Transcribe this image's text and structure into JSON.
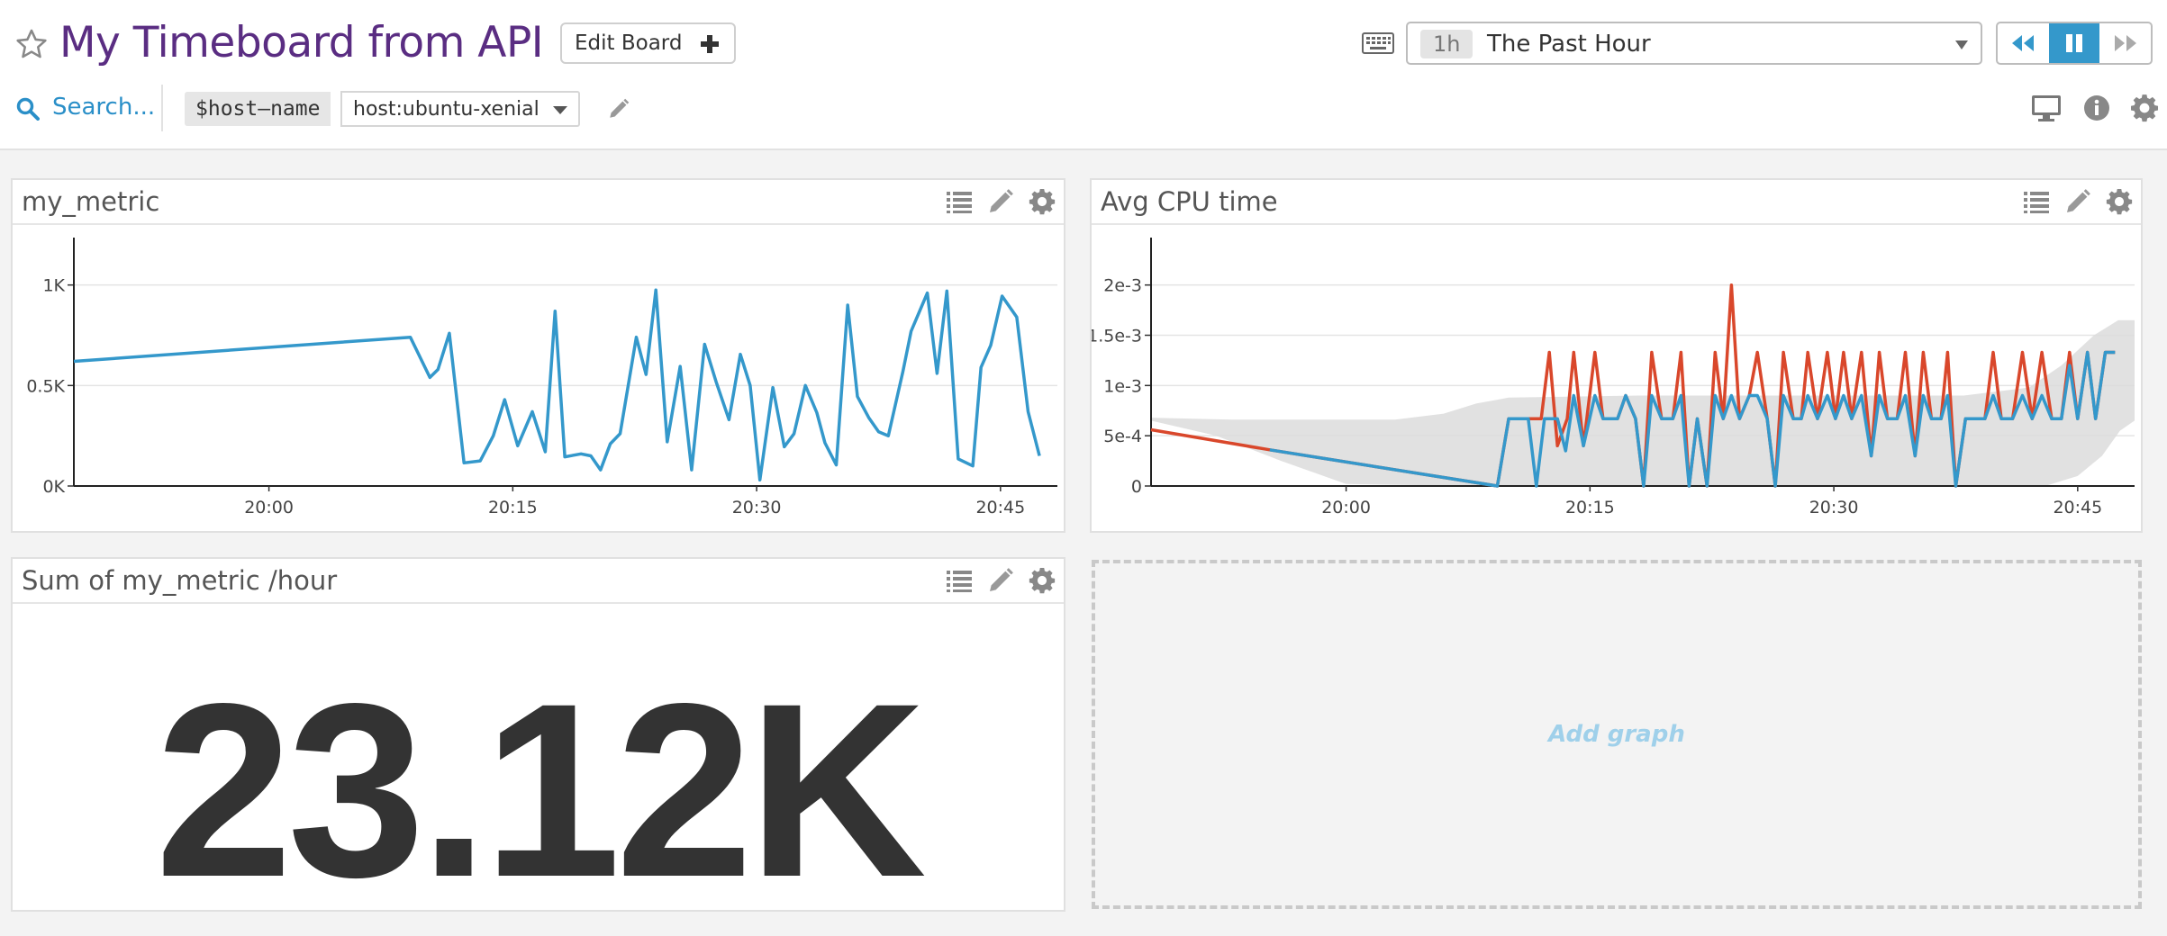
{
  "header": {
    "title": "My Timeboard from API",
    "edit_board_label": "Edit Board",
    "timeframe": {
      "abbr": "1h",
      "label": "The Past Hour"
    },
    "search_label": "Search...",
    "template_variable": {
      "name": "$host–name",
      "value": "host:ubuntu-xenial"
    }
  },
  "colors": {
    "accent": "#3498cb",
    "title": "#5a2d82",
    "series_red": "#d9472b",
    "band": "#dcdcdc"
  },
  "widgets": {
    "my_metric": {
      "title": "my_metric"
    },
    "avg_cpu": {
      "title": "Avg CPU time"
    },
    "sum_metric": {
      "title": "Sum of my_metric /hour",
      "value": "23.12K"
    },
    "add_graph": {
      "label": "Add graph"
    }
  },
  "chart_data": [
    {
      "type": "line",
      "id": "my_metric",
      "title": "my_metric",
      "x_ticks": [
        "20:00",
        "20:15",
        "20:30",
        "20:45"
      ],
      "x_tick_minutes": [
        12,
        27,
        42,
        57
      ],
      "xlim_minutes": [
        0,
        60.5
      ],
      "y_ticks": [
        "0K",
        "0.5K",
        "1K"
      ],
      "y_tick_values": [
        0,
        500,
        1000
      ],
      "ylim": [
        0,
        1200
      ],
      "series": [
        {
          "color": "#3498cb",
          "points": [
            [
              0,
              620
            ],
            [
              20.7,
              740
            ],
            [
              21.9,
              540
            ],
            [
              22.4,
              580
            ],
            [
              23.1,
              760
            ],
            [
              24,
              115
            ],
            [
              25,
              125
            ],
            [
              25.8,
              250
            ],
            [
              26.5,
              430
            ],
            [
              27.3,
              200
            ],
            [
              28.2,
              370
            ],
            [
              29,
              170
            ],
            [
              29.6,
              870
            ],
            [
              30.2,
              145
            ],
            [
              31.2,
              160
            ],
            [
              31.8,
              150
            ],
            [
              32.4,
              80
            ],
            [
              33,
              210
            ],
            [
              33.6,
              260
            ],
            [
              34.6,
              740
            ],
            [
              35.2,
              555
            ],
            [
              35.8,
              975
            ],
            [
              36.5,
              220
            ],
            [
              37.3,
              595
            ],
            [
              38,
              80
            ],
            [
              38.8,
              705
            ],
            [
              39.5,
              520
            ],
            [
              40.3,
              330
            ],
            [
              41,
              655
            ],
            [
              41.6,
              500
            ],
            [
              42.2,
              30
            ],
            [
              43,
              490
            ],
            [
              43.7,
              195
            ],
            [
              44.3,
              260
            ],
            [
              45,
              500
            ],
            [
              45.7,
              365
            ],
            [
              46.2,
              215
            ],
            [
              46.9,
              105
            ],
            [
              47.6,
              900
            ],
            [
              48.2,
              445
            ],
            [
              48.9,
              340
            ],
            [
              49.5,
              270
            ],
            [
              50.1,
              250
            ],
            [
              51,
              570
            ],
            [
              51.5,
              770
            ],
            [
              52.5,
              960
            ],
            [
              53.1,
              560
            ],
            [
              53.7,
              970
            ],
            [
              54.4,
              135
            ],
            [
              55.3,
              100
            ],
            [
              55.8,
              590
            ],
            [
              56.4,
              700
            ],
            [
              57.1,
              945
            ],
            [
              58,
              840
            ],
            [
              58.7,
              370
            ],
            [
              59.4,
              150
            ]
          ]
        }
      ]
    },
    {
      "type": "line",
      "id": "avg_cpu",
      "title": "Avg CPU time",
      "x_ticks": [
        "20:00",
        "20:15",
        "20:30",
        "20:45"
      ],
      "x_tick_minutes": [
        12,
        27,
        42,
        57
      ],
      "xlim_minutes": [
        0,
        60.5
      ],
      "y_ticks": [
        "0",
        "5e-4",
        "1e-3",
        "1.5e-3",
        "2e-3"
      ],
      "y_tick_values": [
        0,
        0.0005,
        0.001,
        0.0015,
        0.002
      ],
      "ylim": [
        0,
        0.0024
      ],
      "band": {
        "upper": [
          [
            0,
            0.00068
          ],
          [
            5,
            0.00066
          ],
          [
            10,
            0.00066
          ],
          [
            15,
            0.00066
          ],
          [
            18,
            0.00072
          ],
          [
            20,
            0.00082
          ],
          [
            22,
            0.00088
          ],
          [
            30,
            0.0009
          ],
          [
            40,
            0.0009
          ],
          [
            50,
            0.0009
          ],
          [
            54,
            0.00098
          ],
          [
            56,
            0.0012
          ],
          [
            58,
            0.0015
          ],
          [
            59.5,
            0.00165
          ],
          [
            60.5,
            0.00165
          ]
        ],
        "lower": [
          [
            0,
            0.00065
          ],
          [
            4,
            0.0005
          ],
          [
            8,
            0.00025
          ],
          [
            12,
            2e-05
          ],
          [
            20,
            0
          ],
          [
            40,
            0
          ],
          [
            55,
            0
          ],
          [
            57,
            0.0001
          ],
          [
            58.5,
            0.0003
          ],
          [
            59.6,
            0.00055
          ],
          [
            60.5,
            0.00065
          ]
        ]
      },
      "series": [
        {
          "color": "#d9472b",
          "points": [
            [
              0,
              0.00056
            ],
            [
              7.3,
              0.00036
            ],
            [
              21.3,
              0
            ],
            [
              22,
              0.00067
            ],
            [
              24,
              0.00067
            ],
            [
              24.5,
              0.00133
            ],
            [
              25,
              0.0004
            ],
            [
              25.6,
              0.00067
            ],
            [
              26,
              0.00133
            ],
            [
              26.6,
              0.0004
            ],
            [
              27.3,
              0.00133
            ],
            [
              27.8,
              0.00067
            ],
            [
              28.7,
              0.00067
            ],
            [
              29.2,
              0.0009
            ],
            [
              29.8,
              0.00067
            ],
            [
              30.3,
              0
            ],
            [
              30.8,
              0.00133
            ],
            [
              31.4,
              0.00067
            ],
            [
              32.1,
              0.00067
            ],
            [
              32.6,
              0.00133
            ],
            [
              33.1,
              0
            ],
            [
              33.6,
              0.00067
            ],
            [
              34.2,
              0
            ],
            [
              34.7,
              0.00133
            ],
            [
              35.2,
              0.00067
            ],
            [
              35.7,
              0.002
            ],
            [
              36.2,
              0.00067
            ],
            [
              36.8,
              0.0009
            ],
            [
              37.3,
              0.00133
            ],
            [
              37.9,
              0.00067
            ],
            [
              38.4,
              0
            ],
            [
              38.9,
              0.00133
            ],
            [
              39.5,
              0.00067
            ],
            [
              40,
              0.00067
            ],
            [
              40.4,
              0.00133
            ],
            [
              41,
              0.00067
            ],
            [
              41.6,
              0.00133
            ],
            [
              42.1,
              0.00067
            ],
            [
              42.6,
              0.00133
            ],
            [
              43.1,
              0.00067
            ],
            [
              43.7,
              0.00133
            ],
            [
              44.3,
              0.0003
            ],
            [
              44.8,
              0.00133
            ],
            [
              45.3,
              0.00067
            ],
            [
              45.9,
              0.00067
            ],
            [
              46.4,
              0.00133
            ],
            [
              47,
              0.0003
            ],
            [
              47.5,
              0.00133
            ],
            [
              48,
              0.00067
            ],
            [
              48.6,
              0.00067
            ],
            [
              49,
              0.00133
            ],
            [
              49.5,
              0
            ],
            [
              50.1,
              0.00067
            ],
            [
              50.7,
              0.00067
            ],
            [
              51.3,
              0.00067
            ],
            [
              51.8,
              0.00133
            ],
            [
              52.3,
              0.00067
            ],
            [
              53,
              0.00067
            ],
            [
              53.6,
              0.00133
            ],
            [
              54.2,
              0.00067
            ],
            [
              54.8,
              0.00133
            ],
            [
              55.4,
              0.00067
            ],
            [
              56,
              0.00067
            ],
            [
              56.5,
              0.00133
            ],
            [
              57,
              0.00067
            ],
            [
              57.6,
              0.00133
            ],
            [
              58.1,
              0.00067
            ],
            [
              58.7,
              0.00133
            ],
            [
              59.3,
              0.00133
            ]
          ]
        },
        {
          "color": "#3498cb",
          "points": [
            [
              7.3,
              0.00036
            ],
            [
              21.3,
              0
            ],
            [
              22,
              0.00067
            ],
            [
              23.2,
              0.00067
            ],
            [
              23.7,
              0
            ],
            [
              24.2,
              0.00067
            ],
            [
              25,
              0.00067
            ],
            [
              25.5,
              0.00035
            ],
            [
              26,
              0.0009
            ],
            [
              26.6,
              0.0004
            ],
            [
              27.3,
              0.0009
            ],
            [
              27.8,
              0.00067
            ],
            [
              28.7,
              0.00067
            ],
            [
              29.2,
              0.0009
            ],
            [
              29.8,
              0.00067
            ],
            [
              30.3,
              0
            ],
            [
              30.8,
              0.0009
            ],
            [
              31.4,
              0.00067
            ],
            [
              32.1,
              0.00067
            ],
            [
              32.6,
              0.0009
            ],
            [
              33.1,
              0
            ],
            [
              33.6,
              0.00067
            ],
            [
              34.2,
              0
            ],
            [
              34.7,
              0.0009
            ],
            [
              35.2,
              0.00067
            ],
            [
              35.7,
              0.0009
            ],
            [
              36.2,
              0.00067
            ],
            [
              36.8,
              0.0009
            ],
            [
              37.3,
              0.0009
            ],
            [
              37.9,
              0.00067
            ],
            [
              38.4,
              0
            ],
            [
              38.9,
              0.0009
            ],
            [
              39.5,
              0.00067
            ],
            [
              40,
              0.00067
            ],
            [
              40.4,
              0.0009
            ],
            [
              41,
              0.00067
            ],
            [
              41.6,
              0.0009
            ],
            [
              42.1,
              0.00067
            ],
            [
              42.6,
              0.0009
            ],
            [
              43.1,
              0.00067
            ],
            [
              43.7,
              0.0009
            ],
            [
              44.3,
              0.0003
            ],
            [
              44.8,
              0.0009
            ],
            [
              45.3,
              0.00067
            ],
            [
              45.9,
              0.00067
            ],
            [
              46.4,
              0.0009
            ],
            [
              47,
              0.0003
            ],
            [
              47.5,
              0.0009
            ],
            [
              48,
              0.00067
            ],
            [
              48.6,
              0.00067
            ],
            [
              49,
              0.0009
            ],
            [
              49.5,
              0
            ],
            [
              50.1,
              0.00067
            ],
            [
              50.7,
              0.00067
            ],
            [
              51.3,
              0.00067
            ],
            [
              51.8,
              0.0009
            ],
            [
              52.3,
              0.00067
            ],
            [
              53,
              0.00067
            ],
            [
              53.6,
              0.0009
            ],
            [
              54.2,
              0.00067
            ],
            [
              54.8,
              0.0009
            ],
            [
              55.4,
              0.00067
            ],
            [
              56,
              0.00067
            ],
            [
              56.5,
              0.0012
            ],
            [
              57,
              0.00067
            ],
            [
              57.6,
              0.00133
            ],
            [
              58.1,
              0.00067
            ],
            [
              58.7,
              0.00133
            ],
            [
              59.3,
              0.00133
            ]
          ]
        }
      ]
    }
  ]
}
